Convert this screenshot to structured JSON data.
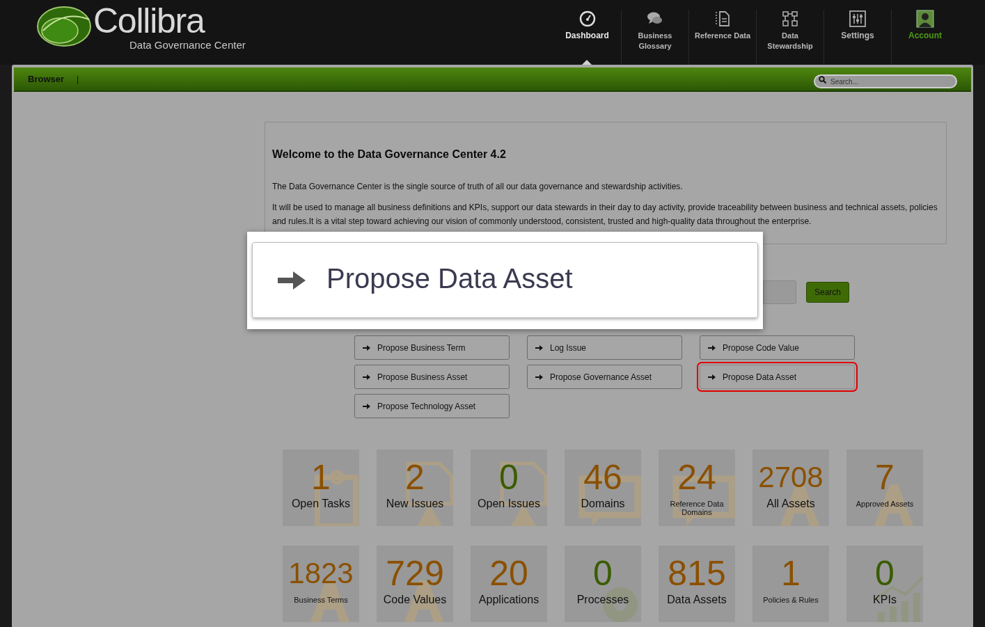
{
  "header": {
    "logo": {
      "name": "Collibra",
      "subtitle": "Data Governance Center"
    },
    "nav": [
      {
        "label": "Dashboard",
        "kind": "gauge",
        "selected": true
      },
      {
        "label": "Business Glossary",
        "kind": "chat",
        "selected": false
      },
      {
        "label": "Reference Data",
        "kind": "doc",
        "selected": false
      },
      {
        "label": "Data Stewardship",
        "kind": "flow",
        "selected": false
      },
      {
        "label": "Settings",
        "kind": "sliders",
        "selected": false
      },
      {
        "label": "Account",
        "kind": "user",
        "selected": false
      }
    ]
  },
  "toolbar": {
    "title": "Browser",
    "separator": "|",
    "search": {
      "placeholder": "Search..."
    }
  },
  "welcome": {
    "title": "Welcome to the Data Governance Center 4.2",
    "paragraphs": [
      "The Data Governance Center is the single source of truth of all our data governance and stewardship activities.",
      "It will be used to manage all business definitions and KPIs, support our data stewards in their day to day activity, provide traceability between business and technical assets, policies and rules.It is a vital step toward achieving our vision of commonly understood, consistent, trusted and high-quality data throughout the enterprise."
    ]
  },
  "search_button": "Search",
  "actions": [
    {
      "label": "Propose Business Term",
      "highlighted": false
    },
    {
      "label": "Log Issue",
      "highlighted": false
    },
    {
      "label": "Propose Code Value",
      "highlighted": false
    },
    {
      "label": "Propose Business Asset",
      "highlighted": false
    },
    {
      "label": "Propose Governance Asset",
      "highlighted": false
    },
    {
      "label": "Propose Data Asset",
      "highlighted": true
    },
    {
      "label": "Propose Technology Asset",
      "highlighted": false
    }
  ],
  "callout": {
    "label": "Propose Data Asset"
  },
  "tiles": [
    {
      "count": "1",
      "label": "Open Tasks",
      "color": "#8a5000",
      "kind": "task"
    },
    {
      "count": "2",
      "label": "New Issues",
      "color": "#8a5000",
      "kind": "issue"
    },
    {
      "count": "0",
      "label": "Open Issues",
      "color": "#3a5c00",
      "kind": "issue"
    },
    {
      "count": "46",
      "label": "Domains",
      "color": "#8a5000",
      "kind": "domain"
    },
    {
      "count": "24",
      "label": "Reference Data Domains",
      "color": "#8a5000",
      "kind": "domain"
    },
    {
      "count": "2708",
      "label": "All Assets",
      "color": "#8a5000",
      "kind": "asset"
    },
    {
      "count": "7",
      "label": "Approved Assets",
      "color": "#8a5000",
      "kind": "asset"
    },
    {
      "count": "1823",
      "label": "Business Terms",
      "color": "#8a5000",
      "kind": "asset"
    },
    {
      "count": "729",
      "label": "Code Values",
      "color": "#8a5000",
      "kind": "asset"
    },
    {
      "count": "20",
      "label": "Applications",
      "color": "#8a5000",
      "kind": "none"
    },
    {
      "count": "0",
      "label": "Processes",
      "color": "#3a5c00",
      "kind": "gear"
    },
    {
      "count": "815",
      "label": "Data Assets",
      "color": "#8a5000",
      "kind": "none"
    },
    {
      "count": "1",
      "label": "Policies & Rules",
      "color": "#8a5000",
      "kind": "none"
    },
    {
      "count": "0",
      "label": "KPIs",
      "color": "#3a5c00",
      "kind": "chart"
    }
  ]
}
